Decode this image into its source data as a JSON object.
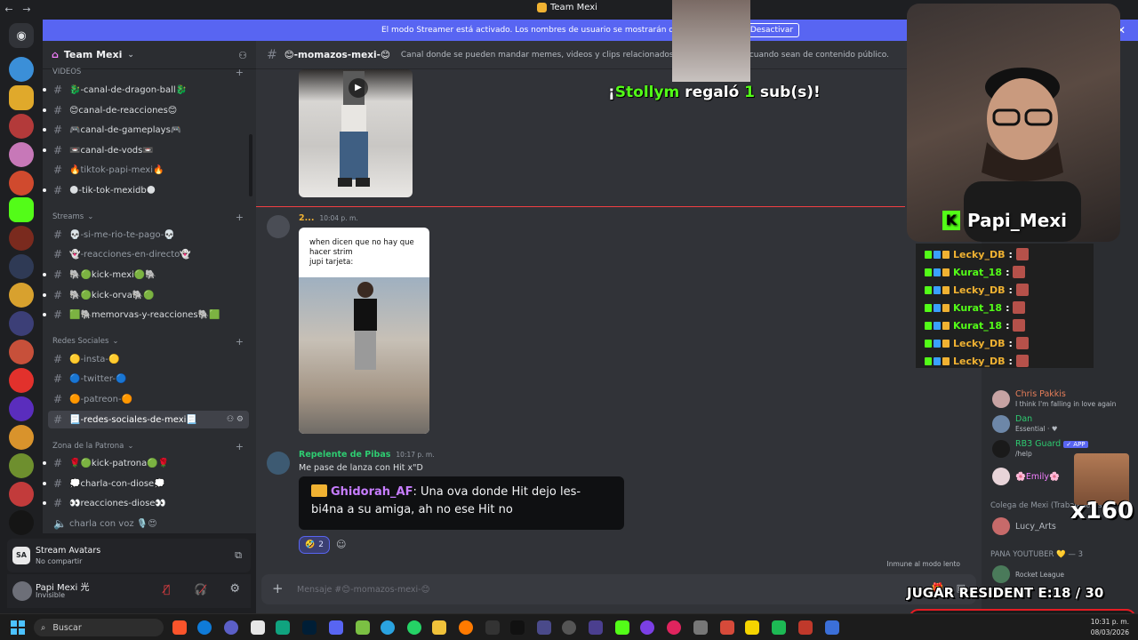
{
  "titlebar": {
    "title": "Team Mexi"
  },
  "banner": {
    "text": "El modo Streamer está activado. Los nombres de usuario se mostrarán de forma parcial.",
    "button": "Desactivar"
  },
  "server": {
    "name": "Team Mexi"
  },
  "categories": {
    "videos": "VIDEOS",
    "streams": "Streams",
    "redes": "Redes Sociales",
    "patrona": "Zona de la Patrona"
  },
  "channels": {
    "dragon": "🐉-canal-de-dragon-ball🐉",
    "reacciones": "😊canal-de-reacciones😊",
    "gameplays": "🎮canal-de-gameplays🎮",
    "vods": "📼canal-de-vods📼",
    "tiktok_papi": "🔥tiktok-papi-mexi🔥",
    "tiktok_db": "🌑-tik-tok-mexidb🌑",
    "rio": "💀-si-me-rio-te-pago-💀",
    "directo": "👻-reacciones-en-directo👻",
    "kick_mexi": "🐘🟢kick-mexi🟢🐘",
    "kick_orva": "🐘🟢kick-orva🐘🟢",
    "memorvas": "🟩🐘memorvas-y-reacciones🐘🟩",
    "insta": "🟡-insta-🟡",
    "twitter": "🔵-twitter-🔵",
    "patreon": "🟠-patreon-🟠",
    "redes_mexi": "📃-redes-sociales-de-mexi📃",
    "kick_patrona": "🌹🟢kick-patrona🟢🌹",
    "charla_diose": "💭charla-con-diose💭",
    "reacciones_diose": "👀reacciones-diose👀",
    "voz": "charla con voz 🎙️😍"
  },
  "stream_panel": {
    "title": "Stream Avatars",
    "subtitle": "No compartir",
    "avatar_text": "SA"
  },
  "user_panel": {
    "name": "Papi Mexi 光",
    "status": "Invisible"
  },
  "chat": {
    "channel": "😊-momazos-mexi-😊",
    "topic": "Canal donde se pueden mandar memes, videos y clips relacionados a Mexi, siempre y cuando sean de contenido público.",
    "msg1": {
      "author": "2...",
      "time": "10:04 p. m."
    },
    "meme_caption": "when dicen que no hay que hacer strim\njupi tarjeta:",
    "msg2": {
      "author": "Repelente de Pibas",
      "time": "10:17 p. m.",
      "text": "Me pase de lanza con Hit x\"D"
    },
    "quote": {
      "who": "Ghidorah_AF",
      "text": ": Una ova donde Hit dejo les-bi4na a su amiga, ah no ese Hit no"
    },
    "reaction": {
      "emoji": "🤣",
      "count": "2"
    },
    "slowmode": "Inmune al modo lento",
    "composer_placeholder": "Mensaje #😊-momazos-mexi-😊"
  },
  "gift": {
    "name": "Stollym",
    "count": "1",
    "prefix": "¡",
    "mid": " regaló ",
    "suffix": " sub(s)!"
  },
  "webcam": {
    "tag": "Papi_Mexi"
  },
  "kick_chat": [
    {
      "user": "Lecky_DB",
      "color": "#f0b232"
    },
    {
      "user": "Kurat_18",
      "color": "#53fc18"
    },
    {
      "user": "Lecky_DB",
      "color": "#f0b232"
    },
    {
      "user": "Kurat_18",
      "color": "#53fc18"
    },
    {
      "user": "Kurat_18",
      "color": "#53fc18"
    },
    {
      "user": "Lecky_DB",
      "color": "#f0b232"
    },
    {
      "user": "Lecky_DB",
      "color": "#f0b232"
    }
  ],
  "members": {
    "chris": {
      "name": "Chris Pakkis",
      "sub": "I think I'm falling in love again"
    },
    "dan": {
      "name": "Dan",
      "sub": "Essential · ♥"
    },
    "rb3": {
      "name": "RB3 Guard",
      "badge": "✓ APP",
      "sub": "/help"
    },
    "emily": {
      "name": "🌸Emily🌸"
    },
    "cat_colega": "Colega de Mexi (Trabajadores)",
    "lucy": {
      "name": "Lucy_Arts"
    },
    "cat_pana": "PANA YOUTUBER 💛 — 3",
    "rocket": {
      "sub": "Rocket League"
    }
  },
  "overlay": {
    "multiplier": "x160",
    "goal": "JUGAR RESIDENT E:18  / 30",
    "goal_current": 18,
    "goal_target": 30
  },
  "taskbar": {
    "search": "Buscar",
    "time": "10:31 p. m.",
    "date": "08/03/2026"
  },
  "colors": {
    "blurple": "#5865f2",
    "kick_green": "#53fc18",
    "danger": "#f23f43"
  }
}
